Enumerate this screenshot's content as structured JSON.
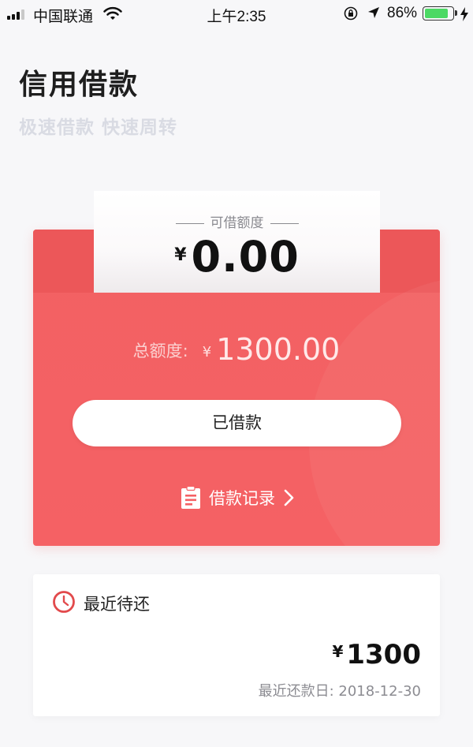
{
  "status_bar": {
    "carrier": "中国联通",
    "time": "上午2:35",
    "battery_percent": "86%",
    "battery_level": 0.86
  },
  "header": {
    "title": "信用借款",
    "subtitle": "极速借款  快速周转"
  },
  "credit_card": {
    "available_label": "可借额度",
    "available_currency": "¥",
    "available_amount": "0.00",
    "total_label": "总额度:",
    "total_currency": "¥",
    "total_amount": "1300.00",
    "borrowed_button_label": "已借款",
    "records_link_label": "借款记录"
  },
  "recent_due": {
    "title": "最近待还",
    "currency": "¥",
    "amount": "1300",
    "date_label": "最近还款日: 2018-12-30"
  },
  "icons": {
    "signal": "signal-icon",
    "wifi": "wifi-icon",
    "rotation_lock": "rotation-lock-icon",
    "location": "location-arrow-icon",
    "battery": "battery-icon",
    "charging": "charging-bolt-icon",
    "records": "document-icon",
    "chevron": "chevron-right-icon",
    "clock": "clock-icon"
  },
  "colors": {
    "card_red": "#f56164",
    "accent_clock": "#e24a4c",
    "battery_green": "#4cd964"
  }
}
